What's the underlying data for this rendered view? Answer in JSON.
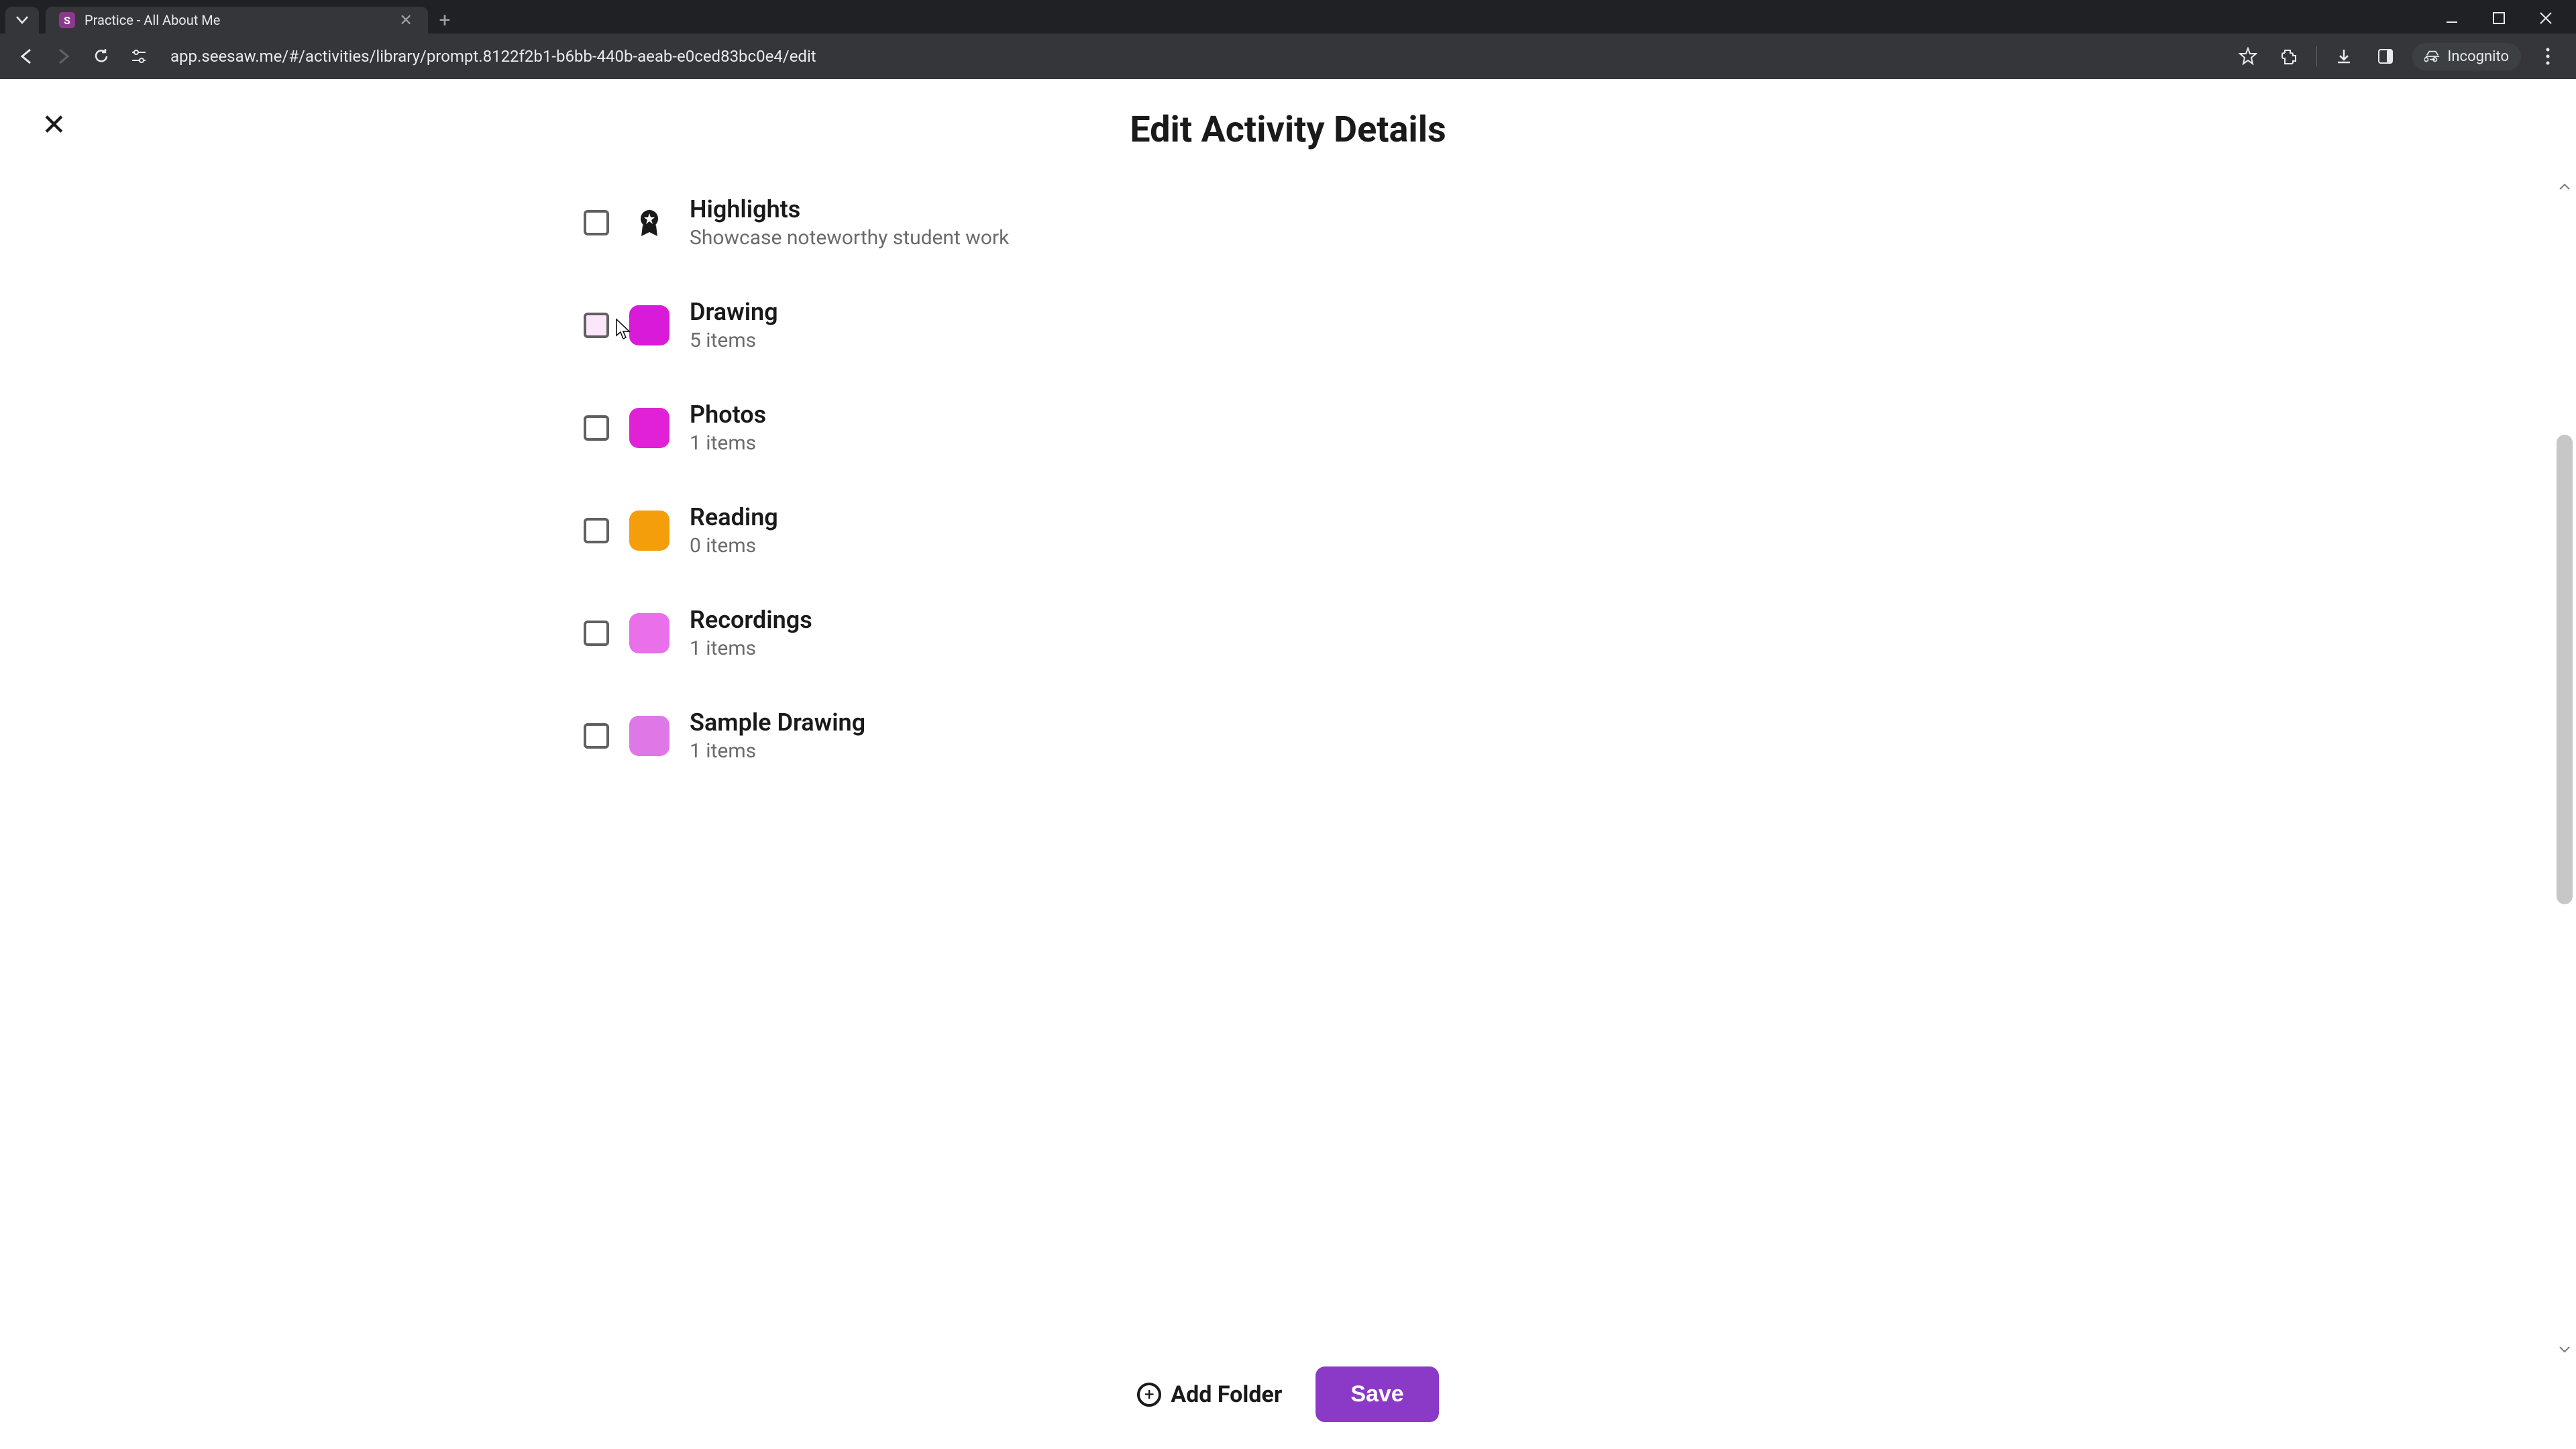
{
  "browser": {
    "tab_title": "Practice - All About Me",
    "url": "app.seesaw.me/#/activities/library/prompt.8122f2b1-b6bb-440b-aeab-e0ced83bc0e4/edit",
    "incognito_label": "Incognito"
  },
  "page": {
    "title": "Edit Activity Details"
  },
  "folders": [
    {
      "name": "Highlights",
      "subtitle": "Showcase noteworthy student work",
      "color": "#transparent",
      "is_highlights": true
    },
    {
      "name": "Drawing",
      "subtitle": "5 items",
      "color": "#d91ad9"
    },
    {
      "name": "Photos",
      "subtitle": "1 items",
      "color": "#e021d5"
    },
    {
      "name": "Reading",
      "subtitle": "0 items",
      "color": "#f59e0b"
    },
    {
      "name": "Recordings",
      "subtitle": "1 items",
      "color": "#e970e9"
    },
    {
      "name": "Sample Drawing",
      "subtitle": "1 items",
      "color": "#e077e6"
    }
  ],
  "actions": {
    "add_folder_label": "Add Folder",
    "save_label": "Save"
  }
}
